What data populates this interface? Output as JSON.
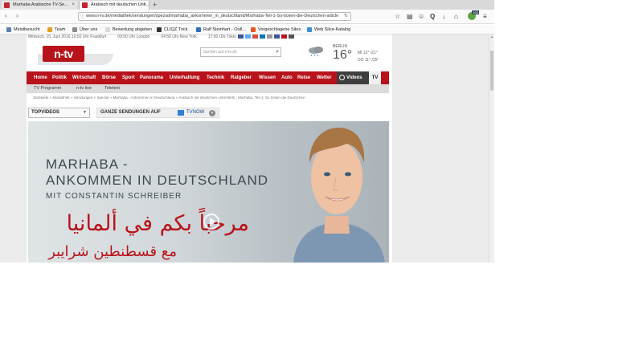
{
  "browser": {
    "tabs": [
      {
        "label": "Marhaba Arabische TV-Se..."
      },
      {
        "label": "Arabisch mit deutschen Unt..."
      }
    ],
    "new_tab": "+",
    "nav": {
      "back": "‹",
      "forward": "›"
    },
    "url": "www.n-tv.de/mediathek/sendungen/spezial/marhaba_ankommen_in_deutschland/Marhaba-Teil-1-So-ticken-die-Deutschen-article",
    "toolbar_icons": [
      "star-icon",
      "reader-icon",
      "smiley-icon",
      "q-icon",
      "download-icon",
      "home-icon",
      "shield-icon",
      "menu-icon"
    ],
    "extension_badge": "103",
    "bookmarks": [
      {
        "label": "Meistbesucht",
        "color": "#5b7fb3"
      },
      {
        "label": "Team",
        "color": "#e0a020"
      },
      {
        "label": "Über uns",
        "color": "#8b8b8b"
      },
      {
        "label": "Bewertung abgeben",
        "color": "#d9d9d9"
      },
      {
        "label": "CLIQZ Trick",
        "color": "#333333"
      },
      {
        "label": "Ralf Steinhart - Outl...",
        "color": "#2f6fbf"
      },
      {
        "label": "Vorgeschlagene Sites",
        "color": "#e95420"
      },
      {
        "label": "Web Slice-Katalog",
        "color": "#3a8ed6"
      }
    ]
  },
  "site": {
    "topinfo": [
      "Mittwoch, 15. Juni 2016 16:50 Uhr Frankfurt",
      "09:50 Uhr London",
      "04:50 Uhr New York",
      "17:50 Uhr Tokio"
    ],
    "logo": "n-tv",
    "search_placeholder": "Suchen auf n-tv.de",
    "weather": {
      "city": "BERLIN",
      "temp": "16°",
      "rows": [
        "MI  12° /21°",
        "DO  11° /25°"
      ]
    },
    "nav": [
      "Home",
      "Politik",
      "Wirtschaft",
      "Börse",
      "Sport",
      "Panorama",
      "Unterhaltung",
      "Technik",
      "Ratgeber",
      "Wissen",
      "Auto",
      "Reise",
      "Wetter"
    ],
    "nav_videos": "Videos",
    "nav_tv": "TV",
    "subnav": [
      "TV Programm",
      "n-tv live",
      "Teletext"
    ],
    "breadcrumb": "Startseite » Mediathek » Sendungen » Spezial » Marhaba - Ankommen in Deutschland » Arabisch mit deutschen Untertiteln : Marhaba, Teil 1: So ticken die Deutschen",
    "topvideos": "TOPVIDEOS",
    "ganze": "GANZE SENDUNGEN AUF",
    "tvnow": "TVNOW",
    "hero": {
      "title1": "MARHABA -",
      "title2": "ANKOMMEN IN DEUTSCHLAND",
      "subtitle": "MIT CONSTANTIN SCHREIBER",
      "arabic1": "مرحباً بكم في ألمانيا",
      "arabic2": "مع قسطنطين شرايبر"
    }
  }
}
